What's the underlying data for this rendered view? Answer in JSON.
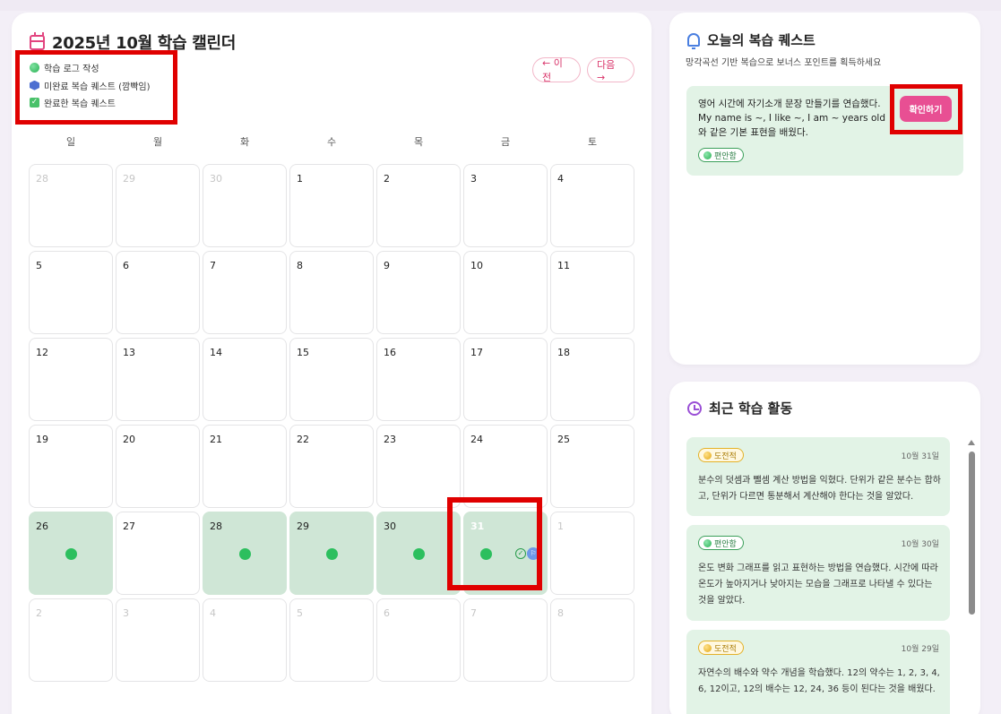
{
  "calendar": {
    "title": "2025년 10월 학습 캘린더",
    "legend": [
      {
        "icon": "green-dot-icon",
        "label": "학습 로그 작성"
      },
      {
        "icon": "blue-hexagon-icon",
        "label": "미완료 복습 퀘스트 (깜빡임)"
      },
      {
        "icon": "green-check-icon",
        "label": "완료한 복습 퀘스트"
      }
    ],
    "prev_label": "← 이전",
    "next_label": "다음 →",
    "weekdays": [
      "일",
      "월",
      "화",
      "수",
      "목",
      "금",
      "토"
    ],
    "weeks": [
      [
        {
          "d": "28",
          "o": true
        },
        {
          "d": "29",
          "o": true
        },
        {
          "d": "30",
          "o": true
        },
        {
          "d": "1"
        },
        {
          "d": "2"
        },
        {
          "d": "3"
        },
        {
          "d": "4"
        }
      ],
      [
        {
          "d": "5"
        },
        {
          "d": "6"
        },
        {
          "d": "7"
        },
        {
          "d": "8"
        },
        {
          "d": "9"
        },
        {
          "d": "10"
        },
        {
          "d": "11"
        }
      ],
      [
        {
          "d": "12"
        },
        {
          "d": "13"
        },
        {
          "d": "14"
        },
        {
          "d": "15"
        },
        {
          "d": "16"
        },
        {
          "d": "17"
        },
        {
          "d": "18"
        }
      ],
      [
        {
          "d": "19"
        },
        {
          "d": "20"
        },
        {
          "d": "21"
        },
        {
          "d": "22"
        },
        {
          "d": "23"
        },
        {
          "d": "24"
        },
        {
          "d": "25"
        }
      ],
      [
        {
          "d": "26",
          "log": true
        },
        {
          "d": "27"
        },
        {
          "d": "28",
          "log": true
        },
        {
          "d": "29",
          "log": true
        },
        {
          "d": "30",
          "log": true
        },
        {
          "d": "31",
          "log": true,
          "today": true,
          "quest": true
        },
        {
          "d": "1",
          "o": true
        }
      ],
      [
        {
          "d": "2",
          "o": true
        },
        {
          "d": "3",
          "o": true
        },
        {
          "d": "4",
          "o": true
        },
        {
          "d": "5",
          "o": true
        },
        {
          "d": "6",
          "o": true
        },
        {
          "d": "7",
          "o": true
        },
        {
          "d": "8",
          "o": true
        }
      ]
    ]
  },
  "quest": {
    "title": "오늘의 복습 퀘스트",
    "subtitle": "망각곡선 기반 복습으로 보너스 포인트를 획득하세요",
    "text": "영어 시간에 자기소개 문장 만들기를 연습했다. My name is ~, I like ~, I am ~ years old와 같은 기본 표현을 배웠다.",
    "tag": "편안함",
    "confirm_label": "확인하기"
  },
  "activity": {
    "title": "최근 학습 활동",
    "items": [
      {
        "tag": "도전적",
        "kind": "challenge",
        "date": "10월 31일",
        "text": "분수의 덧셈과 뺄셈 계산 방법을 익혔다. 단위가 같은 분수는 합하고, 단위가 다르면 통분해서 계산해야 한다는 것을 알았다."
      },
      {
        "tag": "편안함",
        "kind": "comfort",
        "date": "10월 30일",
        "text": "온도 변화 그래프를 읽고 표현하는 방법을 연습했다. 시간에 따라 온도가 높아지거나 낮아지는 모습을 그래프로 나타낼 수 있다는 것을 알았다."
      },
      {
        "tag": "도전적",
        "kind": "challenge",
        "date": "10월 29일",
        "text": "자연수의 배수와 약수 개념을 학습했다. 12의 약수는 1, 2, 3, 4, 6, 12이고, 12의 배수는 12, 24, 36 등이 된다는 것을 배웠다."
      }
    ]
  }
}
